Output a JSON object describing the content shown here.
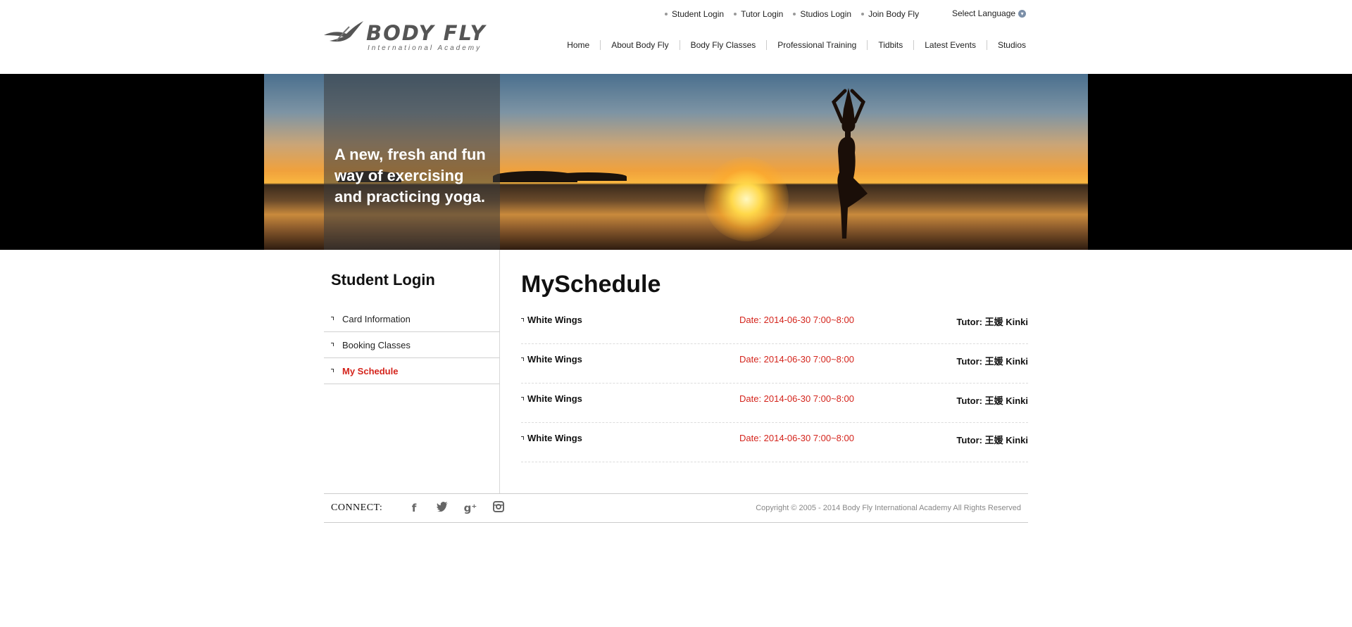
{
  "brand": {
    "name": "BODY FLY",
    "tagline": "International Academy"
  },
  "topbar": {
    "links": [
      "Student Login",
      "Tutor Login",
      "Studios Login",
      "Join Body Fly"
    ],
    "language": "Select Language"
  },
  "mainnav": [
    "Home",
    "About Body Fly",
    "Body Fly Classes",
    "Professional Training",
    "Tidbits",
    "Latest Events",
    "Studios"
  ],
  "banner": {
    "text": "A new, fresh and fun way of exercising and practicing yoga."
  },
  "sidebar": {
    "title": "Student Login",
    "items": [
      "Card Information",
      "Booking Classes",
      "My Schedule"
    ],
    "active_index": 2
  },
  "main": {
    "title": "MySchedule",
    "schedule": [
      {
        "class": "White Wings",
        "date": "Date: 2014-06-30 7:00~8:00",
        "tutor": "Tutor: 王媛 Kinki"
      },
      {
        "class": "White Wings",
        "date": "Date: 2014-06-30 7:00~8:00",
        "tutor": "Tutor: 王媛 Kinki"
      },
      {
        "class": "White Wings",
        "date": "Date: 2014-06-30 7:00~8:00",
        "tutor": "Tutor: 王媛 Kinki"
      },
      {
        "class": "White Wings",
        "date": "Date: 2014-06-30 7:00~8:00",
        "tutor": "Tutor: 王媛 Kinki"
      }
    ]
  },
  "footer": {
    "connect": "CONNECT:",
    "socials": [
      "facebook-icon",
      "twitter-icon",
      "google-plus-icon",
      "instagram-icon"
    ],
    "copyright": "Copyright © 2005 - 2014 Body Fly International Academy All Rights Reserved"
  },
  "colors": {
    "accent": "#d4241c"
  }
}
